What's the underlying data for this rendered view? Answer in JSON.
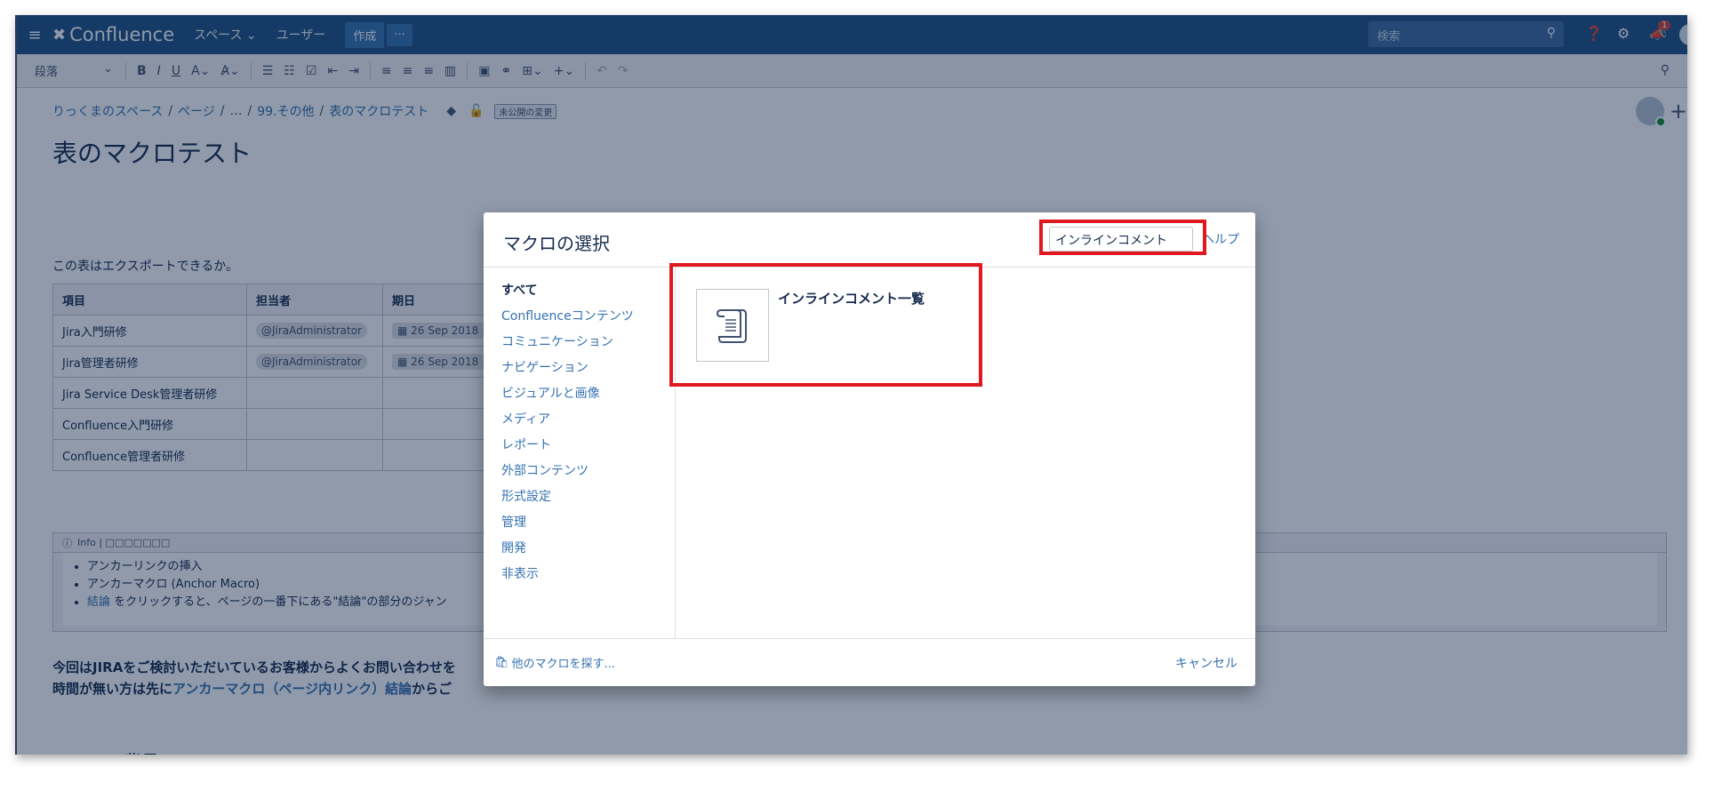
{
  "nav": {
    "app_name": "Confluence",
    "spaces": "スペース",
    "users": "ユーザー",
    "create": "作成",
    "more": "···",
    "search_placeholder": "検索",
    "notification_count": "1"
  },
  "toolbar": {
    "paragraph": "段落"
  },
  "page": {
    "breadcrumb": [
      "りっくまのスペース",
      "ページ",
      "…",
      "99.その他",
      "表のマクロテスト"
    ],
    "unpublished": "未公開の変更",
    "title": "表のマクロテスト",
    "question": "この表はエクスポートできるか。",
    "table": {
      "headers": [
        "項目",
        "担当者",
        "期日"
      ],
      "rows": [
        [
          "Jira入門研修",
          "@JiraAdministrator",
          "26 Sep 2018"
        ],
        [
          "Jira管理者研修",
          "@JiraAdministrator",
          "26 Sep 2018"
        ],
        [
          "Jira Service Desk管理者研修",
          "",
          ""
        ],
        [
          "Confluence入門研修",
          "",
          ""
        ],
        [
          "Confluence管理者研修",
          "",
          ""
        ]
      ]
    },
    "info": {
      "header": "Info | □□□□□□□",
      "items": [
        "アンカーリンクの挿入",
        "アンカーマクロ (Anchor Macro)"
      ],
      "item3_link": "結論",
      "item3_text": " をクリックすると、ページの一番下にある\"結論\"の部分のジャン"
    },
    "para_line1": "今回はJIRAをご検討いただいているお客様からよくお問い合わせを",
    "para_line2_prefix": "時間が無い方は先に",
    "para_line2_link1": "アンカーマクロ（ページ内リンク）",
    "para_line2_link2": "結論",
    "para_line2_suffix": "からご",
    "section_heading": "ツールの背景"
  },
  "dialog": {
    "title": "マクロの選択",
    "search_value": "インラインコメント",
    "help": "ヘルプ",
    "categories": [
      "すべて",
      "Confluenceコンテンツ",
      "コミュニケーション",
      "ナビゲーション",
      "ビジュアルと画像",
      "メディア",
      "レポート",
      "外部コンテンツ",
      "形式設定",
      "管理",
      "開発",
      "非表示"
    ],
    "result_name": "インラインコメント一覧",
    "more_macros": "他のマクロを探す...",
    "cancel": "キャンセル"
  }
}
